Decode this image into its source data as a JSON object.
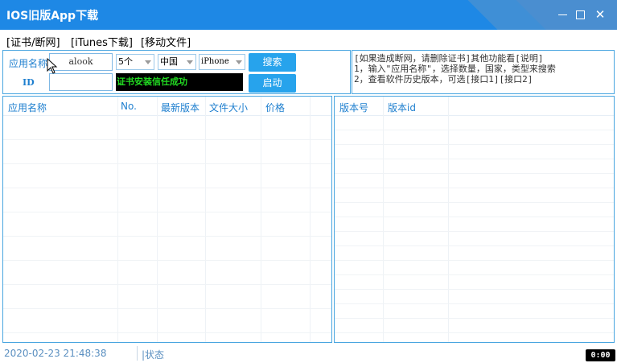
{
  "window": {
    "title": "IOS旧版App下载",
    "minimize_icon": "minimize-icon",
    "maximize_icon": "maximize-icon",
    "close_glyph": "✕"
  },
  "menu": {
    "items": [
      "[证书/断网]",
      "[iTunes下载]",
      "[移动文件]"
    ]
  },
  "search": {
    "app_name_label": "应用名称",
    "id_label": "ID",
    "app_name_value": "alook",
    "id_value": "",
    "count_select": "5个",
    "country_select": "中国",
    "type_select": "iPhone",
    "search_button": "搜索",
    "start_button": "启动",
    "cert_status": "证书安装信任成功"
  },
  "info": {
    "lines": [
      "[如果造成断网，请删除证书]其他功能看[说明]",
      "1，输入\"应用名称\"，选择数量，国家，类型来搜索",
      "2，查看软件历史版本，可选[接口1][接口2]"
    ]
  },
  "results_table": {
    "columns": [
      "应用名称",
      "No.",
      "最新版本",
      "文件大小",
      "价格"
    ],
    "rows": []
  },
  "versions_table": {
    "columns": [
      "版本号",
      "版本id"
    ],
    "rows": []
  },
  "statusbar": {
    "datetime": "2020-02-23 21:48:38",
    "status": "|状态"
  },
  "overlay": {
    "clock": "0:00"
  },
  "colors": {
    "titlebar": "#1e88e5",
    "accent": "#27a3ec",
    "border": "#4aa6e0",
    "label": "#1e7fcf",
    "status_ok": "#22dd22"
  }
}
